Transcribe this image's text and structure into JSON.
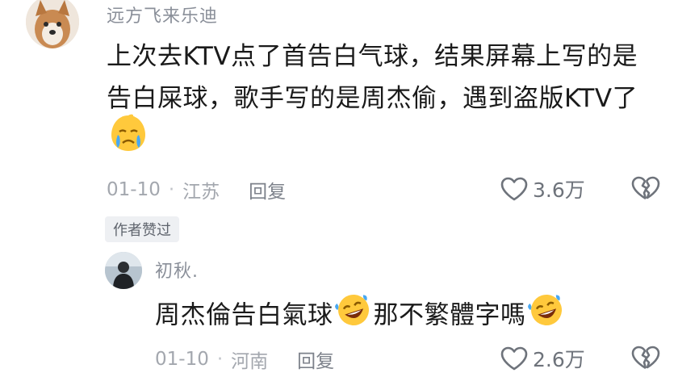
{
  "comment": {
    "username": "远方飞来乐迪",
    "text_line1": "上次去KTV点了首告白气球，结果屏幕上写的是",
    "text_line2": "告白屎球，歌手写的是周杰偷，遇到盗版KTV了",
    "emoji": "crying-face-emoji",
    "date": "01-10",
    "separator": "·",
    "location": "江苏",
    "reply_label": "回复",
    "like_count": "3.6万",
    "author_liked_badge": "作者赞过"
  },
  "reply": {
    "username": "初秋.",
    "text_part1": "周杰倫告白氣球",
    "text_part2": "那不繁體字嗎",
    "emoji": "rofl-emoji",
    "date": "01-10",
    "separator": "·",
    "location": "河南",
    "reply_label": "回复",
    "like_count": "2.6万"
  },
  "colors": {
    "meta_text": "#a3a7ae",
    "username": "#8a8f99",
    "comment_text": "#1a1a1a",
    "badge_bg": "#eef0f3"
  }
}
